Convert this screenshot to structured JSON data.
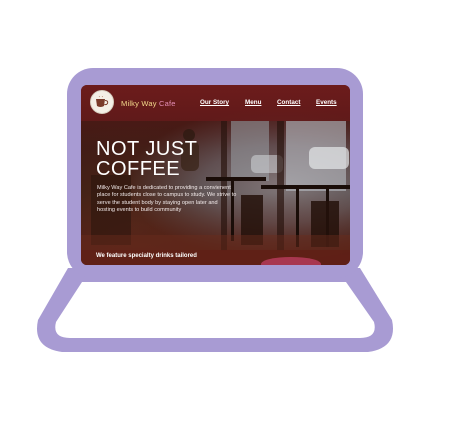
{
  "site": {
    "brand_part1": "Milky Way ",
    "brand_part2": "Cafe",
    "logo_icon": "coffee-cup-icon"
  },
  "nav": {
    "items": [
      {
        "label": "Our Story"
      },
      {
        "label": "Menu"
      },
      {
        "label": "Contact"
      },
      {
        "label": "Events"
      }
    ]
  },
  "hero": {
    "title_line1": "NOT JUST",
    "title_line2": "COFFEE",
    "body": "Milky Way Cafe is dedicated to providing a convienent place for students close to campus to study. We strive to serve the student body by staying open later and hosting events to build community"
  },
  "feature": {
    "text": "We feature specialty drinks tailored"
  },
  "colors": {
    "laptop_outline": "#a89bd3",
    "nav_bg": "#6e1c1c",
    "brand_gold": "#f3d98b",
    "brand_pink": "#e58fb7"
  }
}
